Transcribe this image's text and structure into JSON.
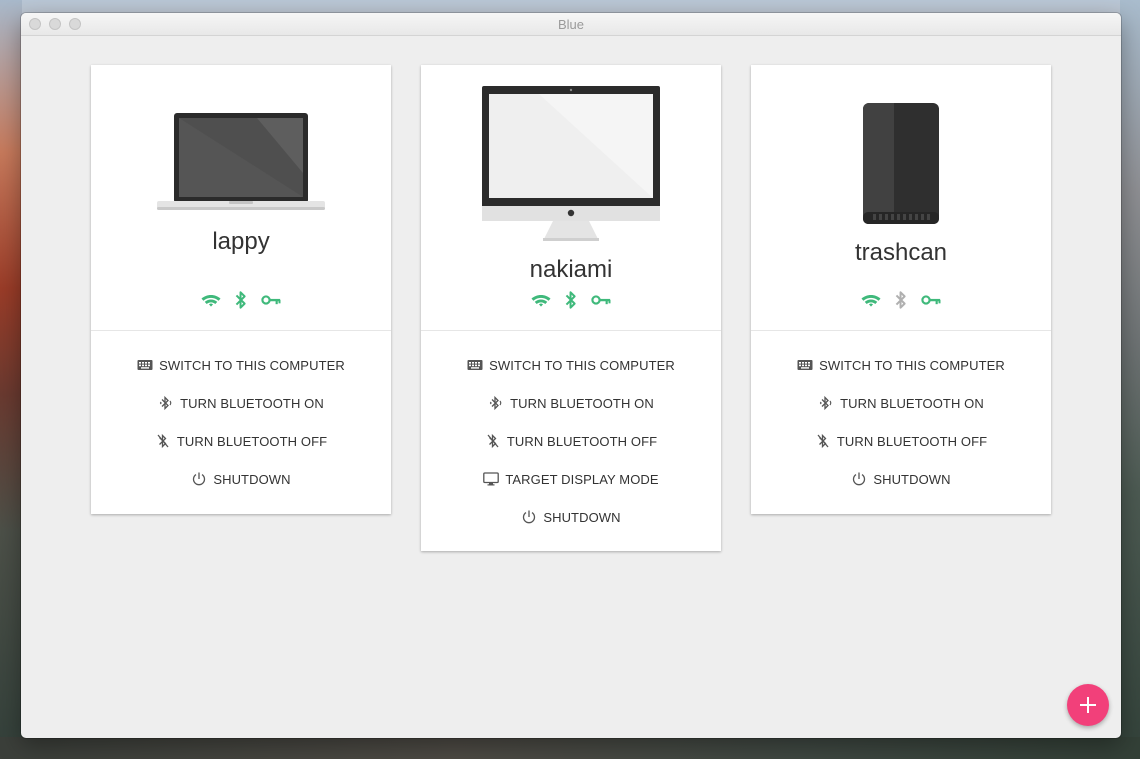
{
  "window": {
    "title": "Blue"
  },
  "colors": {
    "status_on": "#3fb97b",
    "status_off": "#b0b0b0",
    "fab": "#f2407a"
  },
  "cards": [
    {
      "name": "lappy",
      "device_icon": "laptop-icon",
      "status": {
        "wifi": "on",
        "bluetooth": "on",
        "key": "on"
      },
      "actions": [
        {
          "icon": "keyboard-icon",
          "label": "SWITCH TO THIS COMPUTER"
        },
        {
          "icon": "bluetooth-on-icon",
          "label": "TURN BLUETOOTH ON"
        },
        {
          "icon": "bluetooth-off-icon",
          "label": "TURN BLUETOOTH OFF"
        },
        {
          "icon": "power-icon",
          "label": "SHUTDOWN"
        }
      ]
    },
    {
      "name": "nakiami",
      "device_icon": "imac-icon",
      "status": {
        "wifi": "on",
        "bluetooth": "on",
        "key": "on"
      },
      "actions": [
        {
          "icon": "keyboard-icon",
          "label": "SWITCH TO THIS COMPUTER"
        },
        {
          "icon": "bluetooth-on-icon",
          "label": "TURN BLUETOOTH ON"
        },
        {
          "icon": "bluetooth-off-icon",
          "label": "TURN BLUETOOTH OFF"
        },
        {
          "icon": "monitor-icon",
          "label": "TARGET DISPLAY MODE"
        },
        {
          "icon": "power-icon",
          "label": "SHUTDOWN"
        }
      ]
    },
    {
      "name": "trashcan",
      "device_icon": "mac-pro-icon",
      "status": {
        "wifi": "on",
        "bluetooth": "off",
        "key": "on"
      },
      "actions": [
        {
          "icon": "keyboard-icon",
          "label": "SWITCH TO THIS COMPUTER"
        },
        {
          "icon": "bluetooth-on-icon",
          "label": "TURN BLUETOOTH ON"
        },
        {
          "icon": "bluetooth-off-icon",
          "label": "TURN BLUETOOTH OFF"
        },
        {
          "icon": "power-icon",
          "label": "SHUTDOWN"
        }
      ]
    }
  ],
  "fab": {
    "icon": "plus-icon"
  }
}
